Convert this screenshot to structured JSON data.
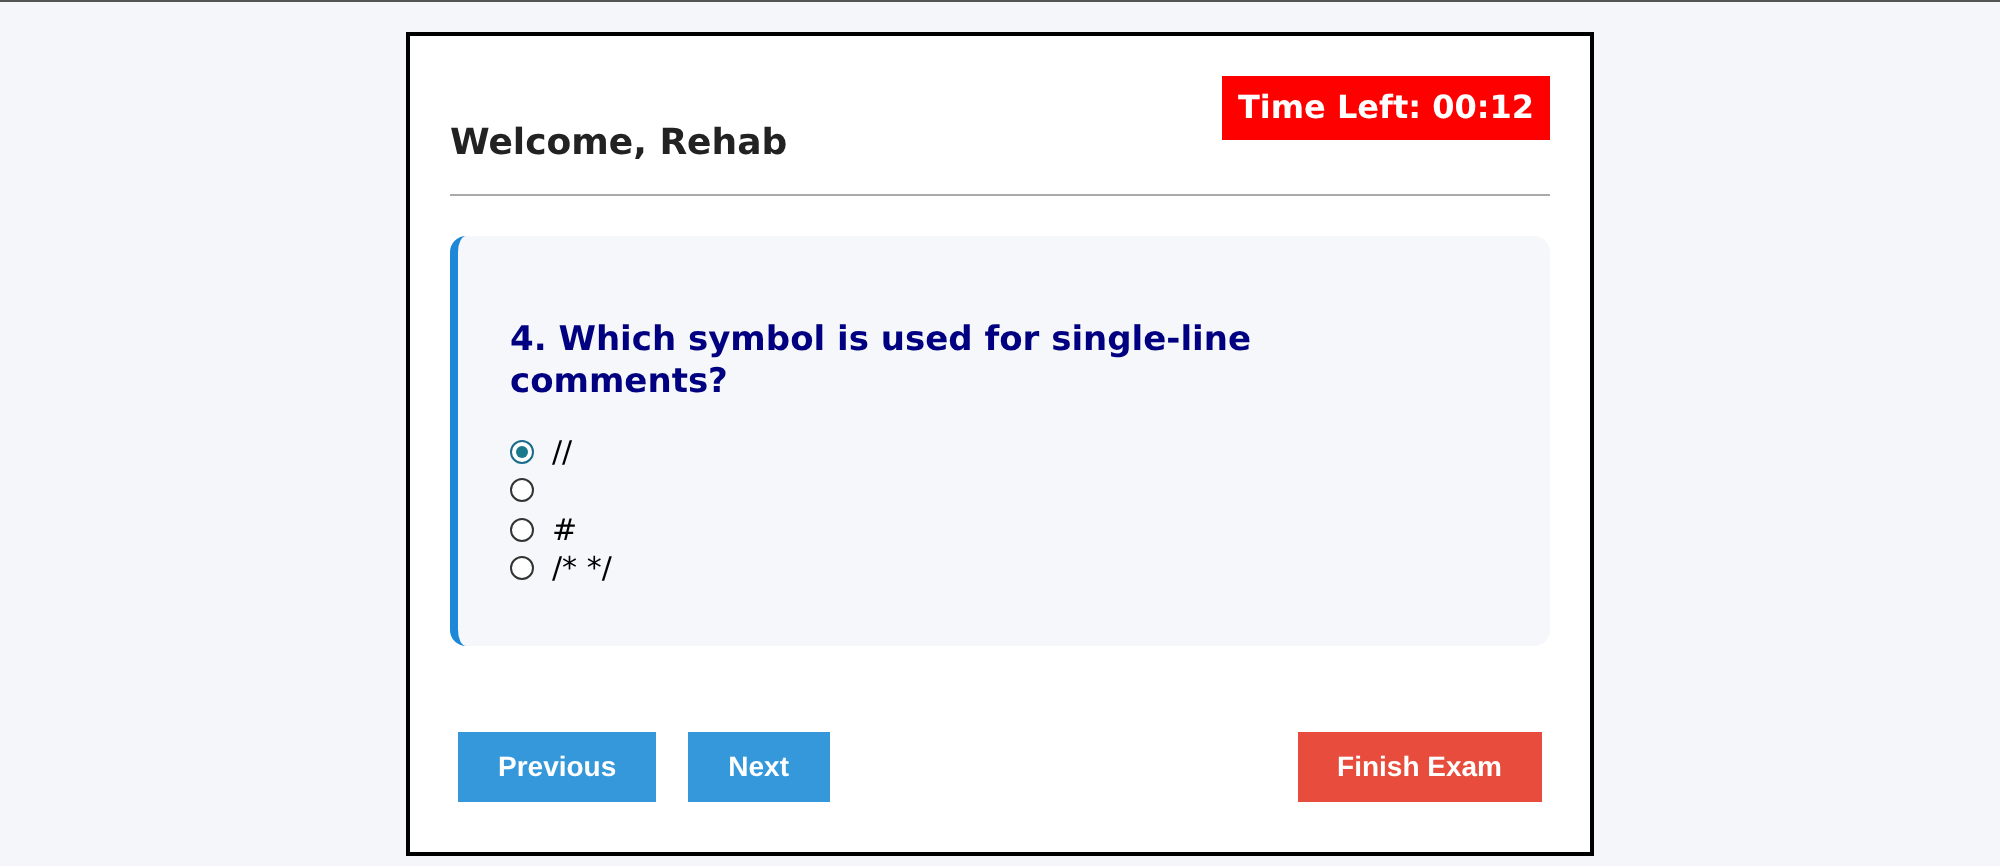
{
  "header": {
    "greeting": "Welcome, Rehab",
    "timer": "Time Left: 00:12"
  },
  "question": {
    "text": "4. Which symbol is used for single-line comments?",
    "options": [
      {
        "label": "//",
        "selected": true
      },
      {
        "selected": false
      },
      {
        "label": "#",
        "selected": false
      },
      {
        "label": "/* */",
        "selected": false
      }
    ]
  },
  "buttons": [
    {
      "label": "Previous",
      "kind": "nav"
    },
    {
      "label": "Next",
      "kind": "nav"
    },
    {
      "label": "Finish Exam",
      "kind": "finish"
    }
  ]
}
